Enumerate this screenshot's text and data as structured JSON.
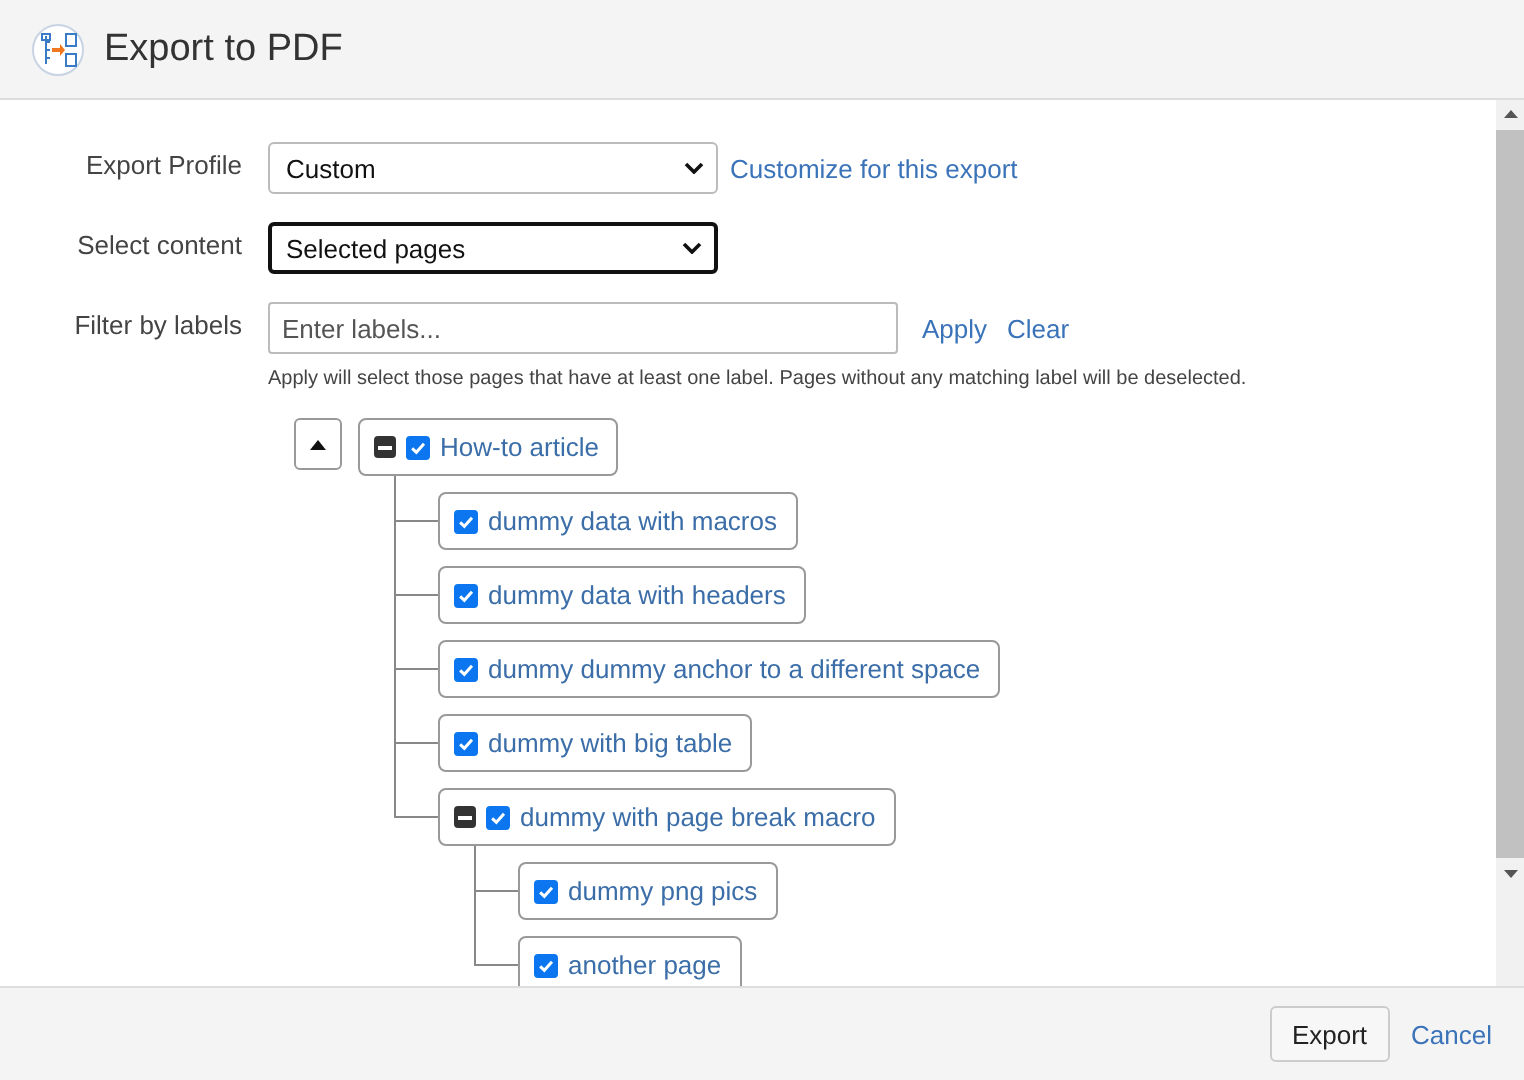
{
  "window": {
    "title": "Export to PDF"
  },
  "form": {
    "fields": [
      {
        "kind": "select",
        "label": "Export Profile",
        "value": "Custom",
        "focused": false,
        "link": "Customize for this export"
      },
      {
        "kind": "select",
        "label": "Select content",
        "value": "Selected pages",
        "focused": true
      },
      {
        "kind": "labels",
        "label": "Filter by labels",
        "placeholder": "Enter labels...",
        "actions": [
          "Apply",
          "Clear"
        ],
        "help": "Apply will select those pages that have at least one label. Pages without any matching label will be deselected."
      }
    ]
  },
  "tree": {
    "nodes": [
      {
        "title": "How-to article",
        "checked": true,
        "expanded": true,
        "children": [
          {
            "title": "dummy data with macros",
            "checked": true
          },
          {
            "title": "dummy data with headers",
            "checked": true
          },
          {
            "title": "dummy dummy anchor to a different space",
            "checked": true
          },
          {
            "title": "dummy with big table",
            "checked": true
          },
          {
            "title": "dummy with page break macro",
            "checked": true,
            "expanded": true,
            "children": [
              {
                "title": "dummy png pics",
                "checked": true
              },
              {
                "title": "another page",
                "checked": true
              }
            ]
          }
        ]
      }
    ]
  },
  "footer": {
    "buttons": [
      {
        "kind": "button",
        "label": "Export"
      },
      {
        "kind": "link",
        "label": "Cancel"
      }
    ]
  }
}
